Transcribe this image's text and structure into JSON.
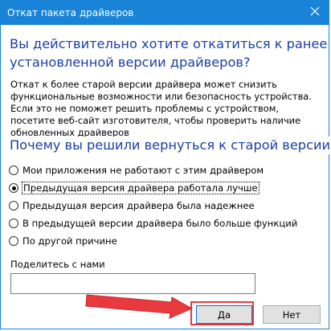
{
  "window": {
    "title": "Откат пакета драйверов"
  },
  "heading": {
    "line1": "Вы действительно хотите откатиться к ранее",
    "line2": "установленной версии драйверов?"
  },
  "description": {
    "line1": "Откат к более старой версии драйвера может снизить",
    "line2": "функциональные возможности или безопасность устройства.",
    "line3": "Если это не поможет решить проблемы с устройством,",
    "line4": "посетите веб-сайт изготовителя, чтобы проверить наличие",
    "line5": "обновленных драйверов"
  },
  "question": "Почему вы решили вернуться к старой версии?",
  "options": [
    {
      "label": "Мои приложения не работают с этим драйвером",
      "checked": false
    },
    {
      "label": "Предыдущая версия драйвера работала лучше",
      "checked": true
    },
    {
      "label": "Предыдущая версия драйвера была надежнее",
      "checked": false
    },
    {
      "label": "В предыдущей версии драйвера было больше функций",
      "checked": false
    },
    {
      "label": "По другой причине",
      "checked": false
    }
  ],
  "share": {
    "label": "Поделитесь с нами",
    "value": ""
  },
  "buttons": {
    "yes": "Да",
    "no": "Нет"
  },
  "colors": {
    "titlebar": "#1883d7",
    "heading": "#1a3fa3",
    "annotation": "#e8393f"
  },
  "icons": {
    "close": "close-icon",
    "annotation_arrow": "arrow-icon"
  }
}
